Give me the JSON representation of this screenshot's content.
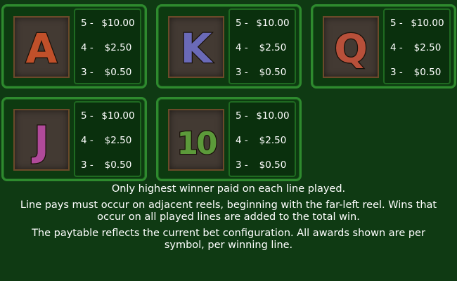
{
  "paytable": {
    "symbols": [
      {
        "glyph": "A",
        "icon": "letter-a-symbol-icon",
        "color": "#c0502a",
        "pays": [
          {
            "count": "5 -",
            "amount": "$10.00"
          },
          {
            "count": "4 -",
            "amount": "$2.50"
          },
          {
            "count": "3 -",
            "amount": "$0.50"
          }
        ]
      },
      {
        "glyph": "K",
        "icon": "letter-k-symbol-icon",
        "color": "#6a6ab8",
        "pays": [
          {
            "count": "5 -",
            "amount": "$10.00"
          },
          {
            "count": "4 -",
            "amount": "$2.50"
          },
          {
            "count": "3 -",
            "amount": "$0.50"
          }
        ]
      },
      {
        "glyph": "Q",
        "icon": "letter-q-symbol-icon",
        "color": "#b8503a",
        "pays": [
          {
            "count": "5 -",
            "amount": "$10.00"
          },
          {
            "count": "4 -",
            "amount": "$2.50"
          },
          {
            "count": "3 -",
            "amount": "$0.50"
          }
        ]
      },
      {
        "glyph": "J",
        "icon": "letter-j-symbol-icon",
        "color": "#b04a9a",
        "pays": [
          {
            "count": "5 -",
            "amount": "$10.00"
          },
          {
            "count": "4 -",
            "amount": "$2.50"
          },
          {
            "count": "3 -",
            "amount": "$0.50"
          }
        ]
      },
      {
        "glyph": "10",
        "icon": "number-ten-symbol-icon",
        "color": "#5c9a3a",
        "pays": [
          {
            "count": "5 -",
            "amount": "$10.00"
          },
          {
            "count": "4 -",
            "amount": "$2.50"
          },
          {
            "count": "3 -",
            "amount": "$0.50"
          }
        ]
      }
    ]
  },
  "rules": {
    "highest_winner": "Only highest winner paid on each line played.",
    "line_pays": "Line pays must occur on adjacent reels, beginning with the far-left reel. Wins that occur on all played lines are added to the total win.",
    "paytable_note": "The paytable reflects the current bet configuration. All awards shown are per symbol, per winning line."
  }
}
